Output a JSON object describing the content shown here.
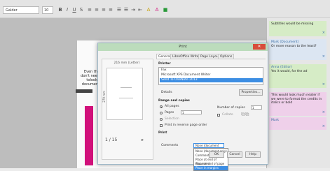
{
  "toolbar": {
    "font_name": "Galder",
    "font_size": "10",
    "icons": [
      "bold-icon",
      "italic-icon",
      "underline-icon",
      "align-left-icon",
      "align-center-icon",
      "align-right-icon",
      "justify-icon",
      "list-icon",
      "indent-icon",
      "highlight-icon",
      "font-color-icon",
      "background-icon"
    ]
  },
  "document": {
    "text_lines": [
      "Even the",
      "don't need",
      "tolookif",
      "document"
    ]
  },
  "comments": [
    {
      "text": "Subtitles would be missing",
      "author": "",
      "close": "×"
    },
    {
      "author": "Mark (Document)",
      "text": "Or more reason to the least?",
      "close": "×"
    },
    {
      "author": "Anna (Editor)",
      "text": "Yes it would, for the ad",
      "close": "×"
    },
    {
      "author": "",
      "text": "This would look much neater if we were to format the credits in italics or bold",
      "close": "×"
    },
    {
      "author": "Mark",
      "text": "",
      "close": "×"
    }
  ],
  "dialog": {
    "title": "Print",
    "close_label": "✕",
    "tabs": [
      "General",
      "LibreOffice Writer",
      "Page Layout",
      "Options"
    ],
    "active_tab": 0,
    "preview": {
      "size_label": "216 mm (Letter)",
      "side_label": "279 mm",
      "page_info": "1 / 15",
      "prev_icon": "◂",
      "next_icon": "▸"
    },
    "printer": {
      "section_label": "Printer",
      "list": [
        "Fax",
        "Microsoft XPS Document Writer",
        "Send To OneNote 2013"
      ],
      "selected": 2,
      "details_label": "Details",
      "properties_label": "Properties..."
    },
    "range": {
      "section_label": "Range and copies",
      "all_pages": "All pages",
      "pages": "Pages",
      "pages_value": "1",
      "selection": "Selection",
      "reverse": "Print in reverse page order",
      "copies_label": "Number of copies",
      "copies_value": "1",
      "collate": "Collate"
    },
    "print": {
      "section_label": "Print",
      "comments_label": "Comments",
      "comments_value": "None (document only)",
      "options": [
        "None (document only)",
        "Comments only",
        "Place at end of document",
        "Place at end of page",
        "Place in margins"
      ],
      "selected_option": 4
    },
    "buttons": {
      "ok": "OK",
      "cancel": "Cancel",
      "help": "Help"
    }
  },
  "colors": {
    "titlebar": "#bcdcbc",
    "close": "#d84c3a",
    "selection": "#3d8ee3",
    "pink_accent": "#d1107a",
    "comment_green": "#d6ecc6",
    "comment_pink": "#efd0ea",
    "comment_blue": "#dce6f2"
  }
}
